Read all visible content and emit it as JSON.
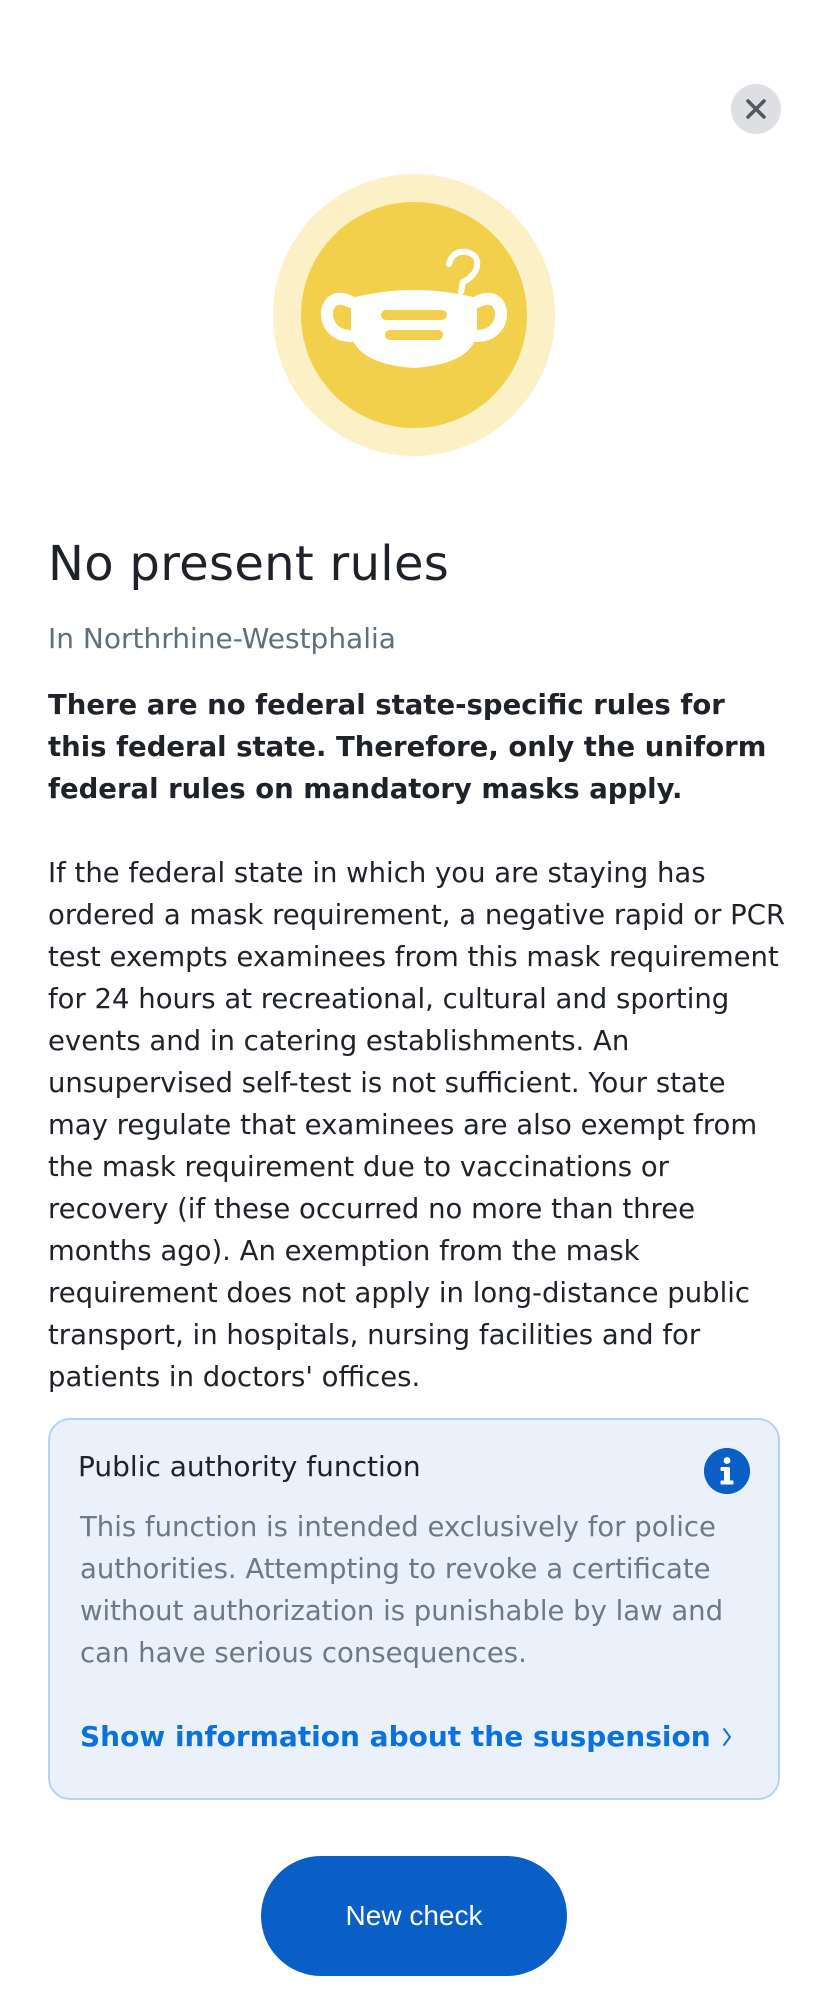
{
  "header": {
    "close_icon": "close-icon"
  },
  "hero": {
    "icon": "mask-question-icon",
    "colors": {
      "outer": "#fbf0c6",
      "inner": "#f2d04c",
      "glyph": "#ffffff"
    }
  },
  "main": {
    "title": "No present rules",
    "subtitle": "In Northrhine-Westphalia",
    "lead": "There are no federal state-specific rules for this federal state. Therefore, only the uniform federal rules on mandatory masks apply.",
    "body": "If the federal state in which you are staying has ordered a mask requirement, a negative rapid or PCR test exempts examinees from this mask requirement for 24 hours at recreational, cultural and sporting events and in catering establishments. An unsupervised self-test is not sufficient. Your state may regulate that examinees are also exempt from the mask requirement due to vaccinations or recovery (if these occurred no more than three months ago). An exemption from the mask requirement does not apply in long-distance public transport, in hospitals, nursing facilities and for patients in doctors' offices."
  },
  "info_box": {
    "title": "Public authority function",
    "icon": "info-icon",
    "text": "This function is intended exclusively for police authorities. Attempting to revoke a certificate without authorization is punishable by law and can have serious consequences.",
    "link_label": "Show information about the suspension"
  },
  "footer": {
    "primary_button": "New check"
  },
  "colors": {
    "accent": "#0a5fc7",
    "link": "#0a72dc",
    "info_bg": "#eaf1fb",
    "info_border": "#b7d2ef"
  }
}
